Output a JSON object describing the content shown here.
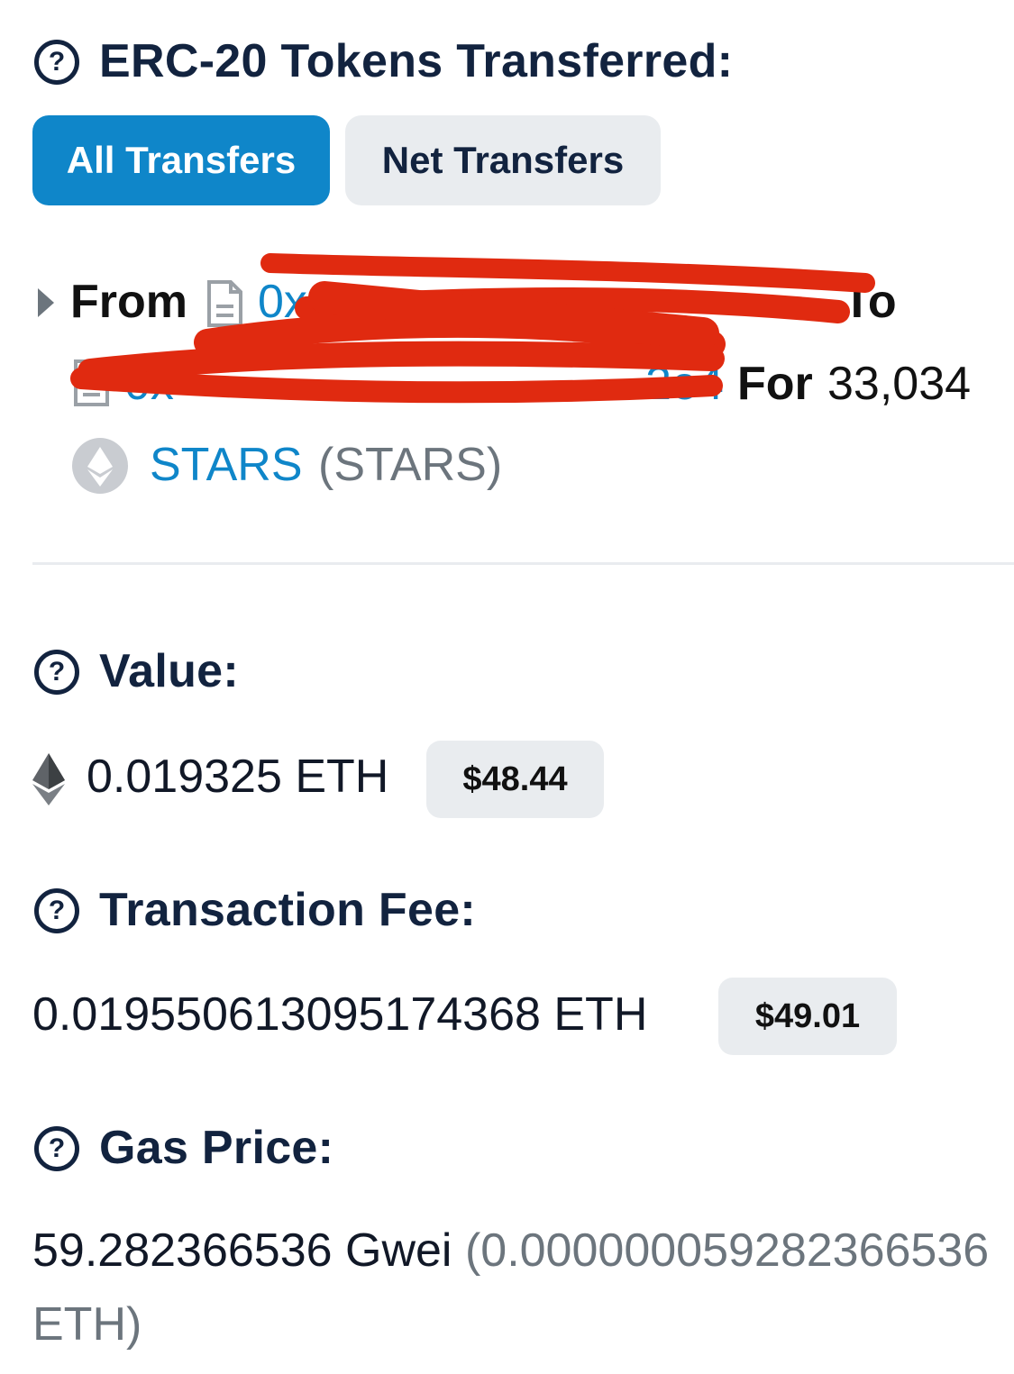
{
  "tokens_section": {
    "heading": "ERC-20 Tokens Transferred:",
    "tabs": [
      {
        "label": "All Transfers",
        "active": true
      },
      {
        "label": "Net Transfers",
        "active": false
      }
    ],
    "transfer": {
      "from_label": "From",
      "from_address_visible": "0xa4",
      "to_label": "To",
      "to_address_visible": "0x",
      "to_address_tail": "2e4",
      "for_label": "For",
      "amount": "33,034",
      "token_name": "STARS",
      "token_symbol": "(STARS)"
    }
  },
  "value_section": {
    "heading": "Value:",
    "eth_amount": "0.019325 ETH",
    "usd": "$48.44"
  },
  "fee_section": {
    "heading": "Transaction Fee:",
    "eth_amount": "0.019550613095174368 ETH",
    "usd": "$49.01"
  },
  "gas_section": {
    "heading": "Gas Price:",
    "gwei": "59.282366536 Gwei",
    "eth_equiv": "(0.000000059282366536",
    "eth_equiv_line2": "ETH)"
  },
  "icons": {
    "help": "question-circle-icon",
    "caret": "caret-right-icon",
    "contract": "document-icon",
    "token": "eth-token-logo-icon",
    "eth": "ethereum-icon"
  },
  "colors": {
    "accent": "#0f86c9",
    "heading": "#12233f",
    "badge_bg": "#e9ecef",
    "redaction": "#e02a10"
  }
}
